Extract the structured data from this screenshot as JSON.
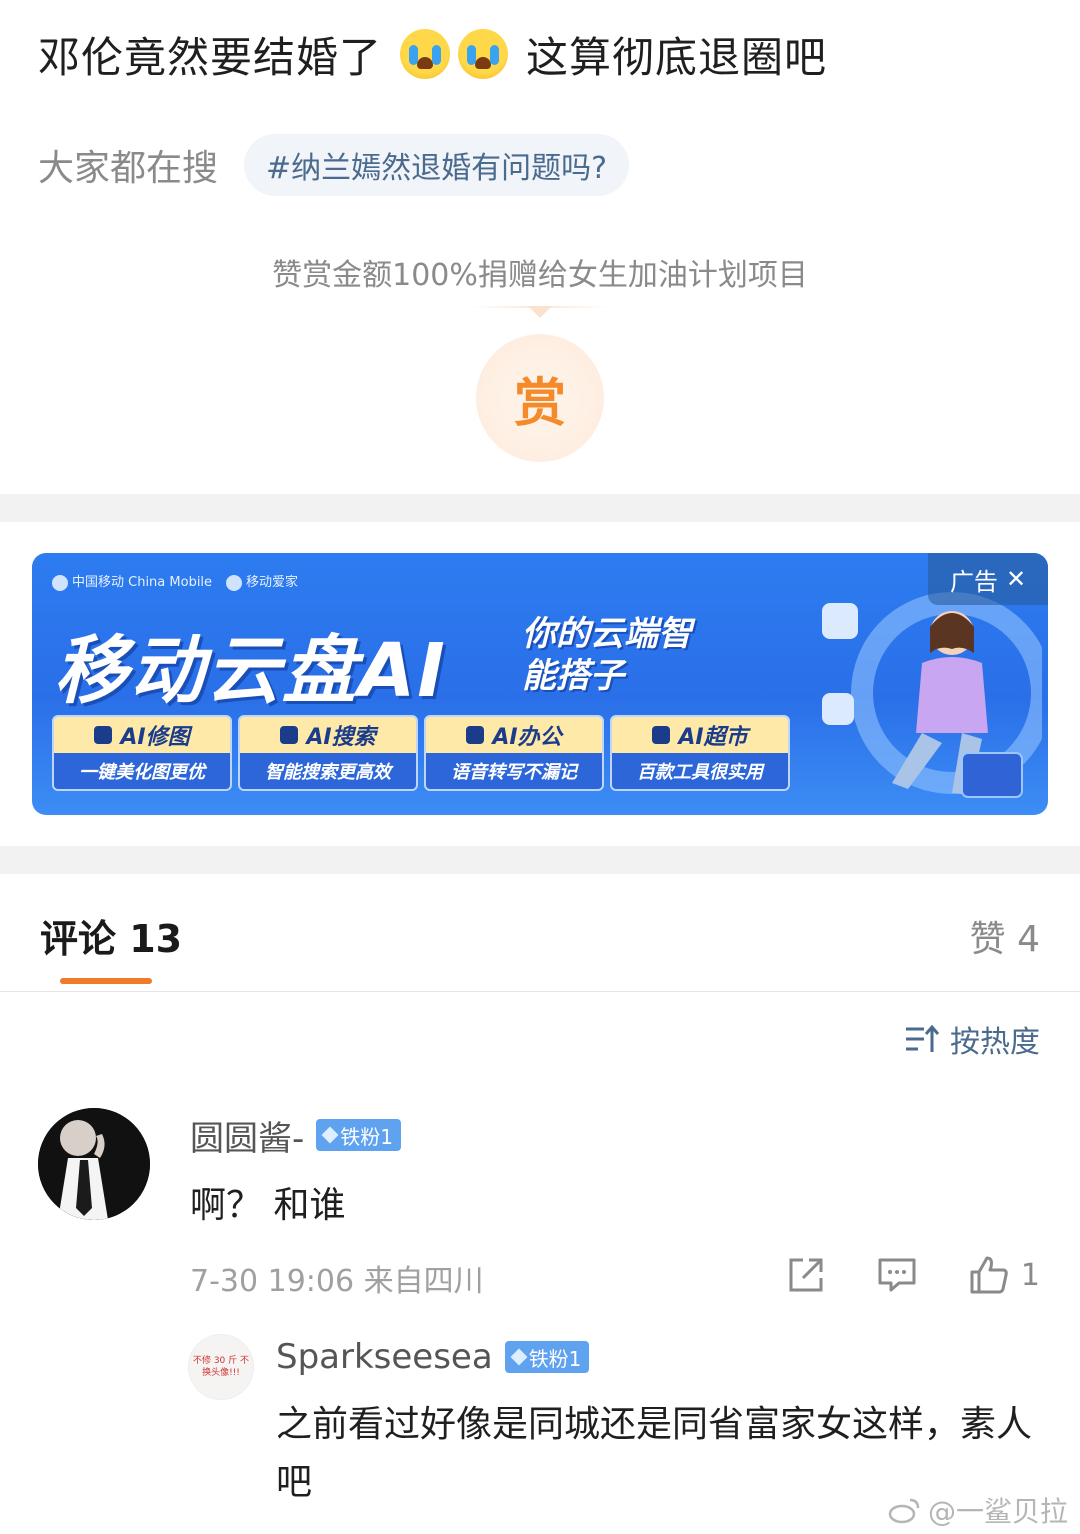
{
  "post": {
    "title_a": "邓伦竟然要结婚了",
    "title_b": "这算彻底退圈吧"
  },
  "search": {
    "label": "大家都在搜",
    "chip": "#纳兰嫣然退婚有问题吗?"
  },
  "reward": {
    "text": "赞赏金额100%捐赠给女生加油计划项目",
    "button": "赏"
  },
  "ad": {
    "brand_a": "中国移动 China Mobile",
    "brand_b": "移动爱家",
    "title": "移动云盘AI",
    "slogan": "你的云端智能搭子",
    "badge": "广告",
    "features": [
      {
        "top": "AI修图",
        "bottom": "一键美化图更优"
      },
      {
        "top": "AI搜索",
        "bottom": "智能搜索更高效"
      },
      {
        "top": "AI办公",
        "bottom": "语音转写不漏记"
      },
      {
        "top": "AI超市",
        "bottom": "百款工具很实用"
      }
    ],
    "accent": "#2d7cf0"
  },
  "comments": {
    "tab_label": "评论 13",
    "likes_label": "赞 4",
    "sort_label": "按热度",
    "accent": "#f07a2a"
  },
  "comment": {
    "user": "圆圆酱-",
    "badge": "铁粉1",
    "text": "啊？ 和谁",
    "meta": "7-30 19:06 来自四川",
    "like_count": "1"
  },
  "reply": {
    "user": "Sparkseesea",
    "badge": "铁粉1",
    "text": "之前看过好像是同城还是同省富家女这样，素人吧",
    "avatar_text": "不修 30 斤 不换头像!!!"
  },
  "watermark": "@一鲨贝拉"
}
